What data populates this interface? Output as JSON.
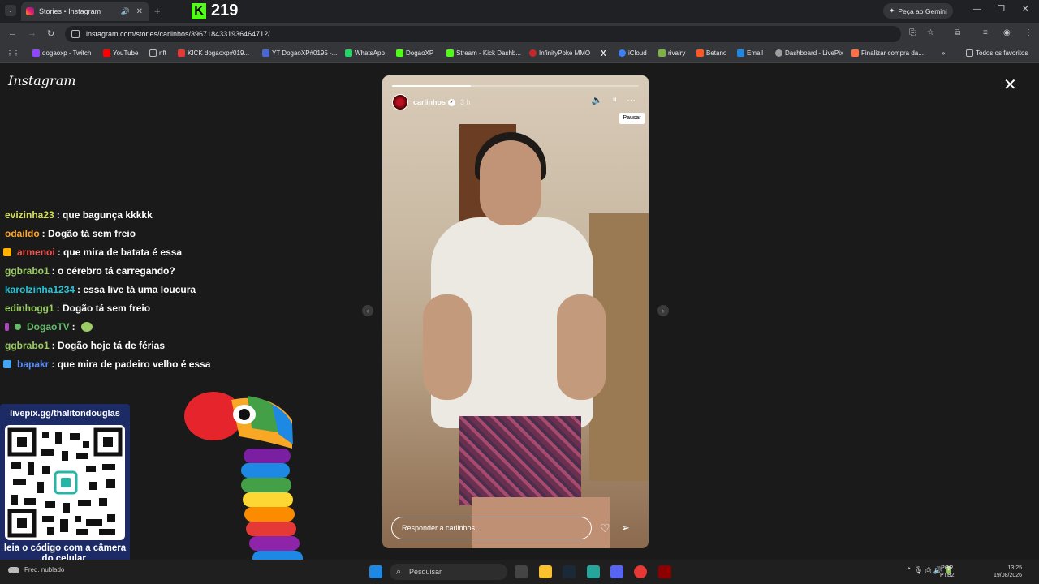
{
  "browser": {
    "tab_title": "Stories • Instagram",
    "tab_close": "✕",
    "tab_audio": "🔊",
    "new_tab": "+",
    "tab_dropdown": "⌄",
    "kick_logo": "K",
    "kick_counter": "219",
    "gemini_label": "Peça ao Gemini",
    "gemini_icon": "✦",
    "url": "instagram.com/stories/carlinhos/3967184331936464712/",
    "nav_back": "←",
    "nav_forward": "→",
    "nav_reload": "↻",
    "win_min": "—",
    "win_max": "❐",
    "win_close": "✕",
    "right_icons": [
      "⎘",
      "☆",
      "⧉",
      "≡",
      "◉",
      "⋮"
    ]
  },
  "bookmarks": {
    "apps_icon": "⋮⋮",
    "items": [
      {
        "label": "dogaoxp - Twitch",
        "color": "#9146ff"
      },
      {
        "label": "YouTube",
        "color": "#ff0000"
      },
      {
        "label": "nft",
        "color": "#888888"
      },
      {
        "label": "KICK dogaoxp#019...",
        "color": "#e53935"
      },
      {
        "label": "YT DogaoXP#0195 -...",
        "color": "#4a67d6"
      },
      {
        "label": "WhatsApp",
        "color": "#25d366"
      },
      {
        "label": "DogaoXP",
        "color": "#53fc18"
      },
      {
        "label": "Stream - Kick Dashb...",
        "color": "#53fc18"
      },
      {
        "label": "InfinityPoke MMO",
        "color": "#c62828"
      },
      {
        "label": "X",
        "color": "#ffffff"
      },
      {
        "label": "iCloud",
        "color": "#3b82f6"
      },
      {
        "label": "rivalry",
        "color": "#7cb342"
      },
      {
        "label": "Betano",
        "color": "#ff5722"
      },
      {
        "label": "Email",
        "color": "#1e88e5"
      },
      {
        "label": "Dashboard - LivePix",
        "color": "#9e9e9e"
      },
      {
        "label": "Finalizar compra da...",
        "color": "#ff7043"
      }
    ],
    "more": "»",
    "favorites": "Todos os favoritos"
  },
  "instagram": {
    "logo": "Instagram",
    "close": "✕",
    "prev_arrow": "‹",
    "next_arrow": "›",
    "story": {
      "progress": 0.32,
      "username": "carlinhos",
      "verified": "✓",
      "time": "3 h",
      "mute_icon": "🔈",
      "pause_icon": "⏸",
      "more_icon": "⋯",
      "pause_tooltip": "Pausar",
      "reply_placeholder": "Responder a carlinhos...",
      "heart_icon": "♡",
      "send_icon": "➢"
    }
  },
  "chat": [
    {
      "user": "evizinha23",
      "text": ": que bagunça kkkkk",
      "color": "#d4e157",
      "badge": ""
    },
    {
      "user": "odaildo",
      "text": ": Dogão tá sem freio",
      "color": "#ffa726",
      "badge": ""
    },
    {
      "user": "armenoi",
      "text": ": que mira de batata é essa",
      "color": "#ef5350",
      "badge": "#ffb300"
    },
    {
      "user": "ggbrabo1",
      "text": ": o cérebro tá carregando?",
      "color": "#9ccc65",
      "badge": ""
    },
    {
      "user": "karolzinha1234",
      "text": ": essa live tá uma loucura",
      "color": "#26c6da",
      "badge": ""
    },
    {
      "user": "edinhogg1",
      "text": ": Dogão tá sem freio",
      "color": "#9ccc65",
      "badge": ""
    },
    {
      "user": "DogaoTV",
      "text": ":",
      "color": "#66bb6a",
      "badge": "#ab47bc"
    },
    {
      "user": "ggbrabo1",
      "text": ": Dogão hoje tá de férias",
      "color": "#9ccc65",
      "badge": ""
    },
    {
      "user": "bapakr",
      "text": ": que mira de padeiro velho é essa",
      "color": "#5c8df6",
      "badge": "#42a5f5"
    }
  ],
  "overlay": {
    "livepix_url": "livepix.gg/thalitondouglas",
    "qr_caption": "leia o código com a câmera do celular."
  },
  "taskbar": {
    "weather": "Fred. nublado",
    "search_placeholder": "Pesquisar",
    "search_icon": "⌕",
    "lang_top": "POR",
    "lang_bottom": "PTB2",
    "time": "13:25",
    "date": "19/08/2026",
    "tray_icons": "⌃  🎙  ⎙ 🔊 🔋"
  }
}
